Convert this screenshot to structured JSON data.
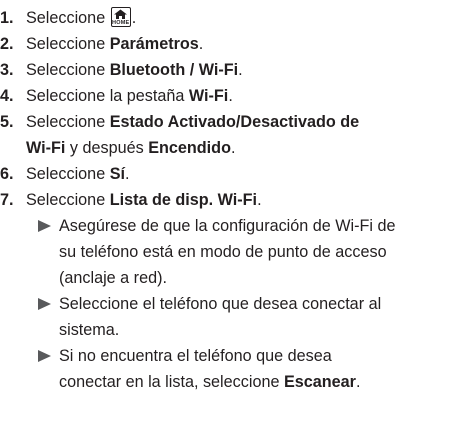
{
  "steps": [
    {
      "num": "1.",
      "pre": "Seleccione",
      "post": "."
    },
    {
      "num": "2.",
      "pre": "Seleccione ",
      "bold": "Parámetros",
      "post": "."
    },
    {
      "num": "3.",
      "pre": "Seleccione ",
      "bold": "Bluetooth / Wi-Fi",
      "post": "."
    },
    {
      "num": "4.",
      "pre": "Seleccione la pestaña ",
      "bold": "Wi-Fi",
      "post": "."
    },
    {
      "num": "5.",
      "pre": "Seleccione ",
      "bold1": "Estado Activado/Desactivado de",
      "bold2": "Wi-Fi",
      "mid": " y después ",
      "bold3": "Encendido",
      "post": "."
    },
    {
      "num": "6.",
      "pre": "Seleccione ",
      "bold": "Sí",
      "post": "."
    },
    {
      "num": "7.",
      "pre": "Seleccione ",
      "bold": "Lista de disp. Wi-Fi",
      "post": "."
    }
  ],
  "home_icon": {
    "label": "HOME",
    "icon": "home-icon"
  },
  "subpoints": [
    {
      "line1": "Asegúrese de que la configuración de Wi-Fi de",
      "line2": "su teléfono está en modo de punto de acceso",
      "line3": "(anclaje a red)."
    },
    {
      "line1": "Seleccione el teléfono que desea conectar al",
      "line2": "sistema."
    },
    {
      "line1": "Si no encuentra el teléfono que desea",
      "line2_pre": "conectar en la lista, seleccione ",
      "line2_bold": "Escanear",
      "line2_post": "."
    }
  ],
  "colors": {
    "text": "#231f20",
    "arrow": "#58595b"
  }
}
